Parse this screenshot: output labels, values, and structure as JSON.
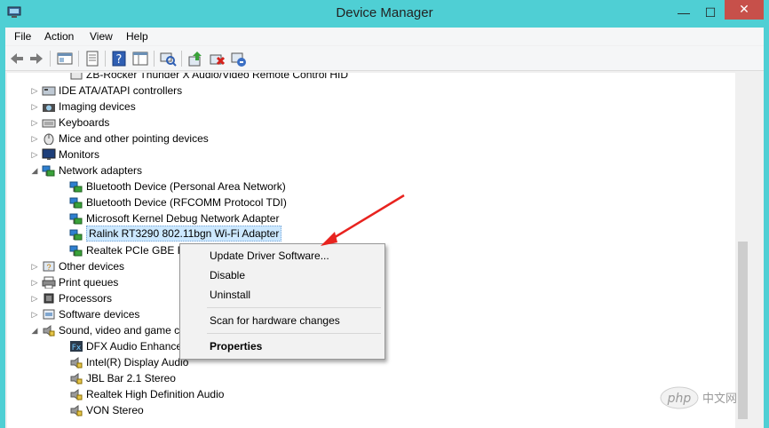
{
  "window": {
    "title": "Device Manager"
  },
  "window_buttons": {
    "minimize": "—",
    "maximize": "☐",
    "close": "✕"
  },
  "menu": [
    "File",
    "Action",
    "View",
    "Help"
  ],
  "tree": [
    {
      "label": "ZB-Rocker Thunder X Audio/Video Remote Control HID",
      "level": 1,
      "icon": "hid-device-icon",
      "expander": ""
    },
    {
      "label": "IDE ATA/ATAPI controllers",
      "level": 0,
      "icon": "ide-controller-icon",
      "expander": "▷"
    },
    {
      "label": "Imaging devices",
      "level": 0,
      "icon": "camera-icon",
      "expander": "▷"
    },
    {
      "label": "Keyboards",
      "level": 0,
      "icon": "keyboard-icon",
      "expander": "▷"
    },
    {
      "label": "Mice and other pointing devices",
      "level": 0,
      "icon": "mouse-icon",
      "expander": "▷"
    },
    {
      "label": "Monitors",
      "level": 0,
      "icon": "monitor-icon",
      "expander": "▷"
    },
    {
      "label": "Network adapters",
      "level": 0,
      "icon": "network-adapter-icon",
      "expander": "◢"
    },
    {
      "label": "Bluetooth Device (Personal Area Network)",
      "level": 1,
      "icon": "network-adapter-icon",
      "expander": ""
    },
    {
      "label": "Bluetooth Device (RFCOMM Protocol TDI)",
      "level": 1,
      "icon": "network-adapter-icon",
      "expander": ""
    },
    {
      "label": "Microsoft Kernel Debug Network Adapter",
      "level": 1,
      "icon": "network-adapter-icon",
      "expander": ""
    },
    {
      "label": "Ralink RT3290 802.11bgn Wi-Fi Adapter",
      "level": 1,
      "icon": "network-adapter-icon",
      "expander": "",
      "selected": true
    },
    {
      "label": "Realtek PCIe GBE Fam",
      "level": 1,
      "icon": "network-adapter-icon",
      "expander": ""
    },
    {
      "label": "Other devices",
      "level": 0,
      "icon": "unknown-device-icon",
      "expander": "▷"
    },
    {
      "label": "Print queues",
      "level": 0,
      "icon": "printer-icon",
      "expander": "▷"
    },
    {
      "label": "Processors",
      "level": 0,
      "icon": "processor-icon",
      "expander": "▷"
    },
    {
      "label": "Software devices",
      "level": 0,
      "icon": "software-device-icon",
      "expander": "▷"
    },
    {
      "label": "Sound, video and game c",
      "level": 0,
      "icon": "speaker-icon",
      "expander": "◢"
    },
    {
      "label": "DFX Audio Enhancer",
      "level": 1,
      "icon": "fx-icon",
      "expander": ""
    },
    {
      "label": "Intel(R) Display Audio",
      "level": 1,
      "icon": "speaker-icon",
      "expander": ""
    },
    {
      "label": "JBL Bar 2.1 Stereo",
      "level": 1,
      "icon": "speaker-icon",
      "expander": ""
    },
    {
      "label": "Realtek High Definition Audio",
      "level": 1,
      "icon": "speaker-icon",
      "expander": ""
    },
    {
      "label": "VON Stereo",
      "level": 1,
      "icon": "speaker-icon",
      "expander": ""
    }
  ],
  "context_menu": {
    "update": "Update Driver Software...",
    "disable": "Disable",
    "uninstall": "Uninstall",
    "scan": "Scan for hardware changes",
    "properties": "Properties"
  },
  "watermark": "php 中文网",
  "colors": {
    "accent": "#4fcfd4",
    "close": "#c7504a",
    "arrow": "#e8231f",
    "selection": "#cce8ff"
  }
}
